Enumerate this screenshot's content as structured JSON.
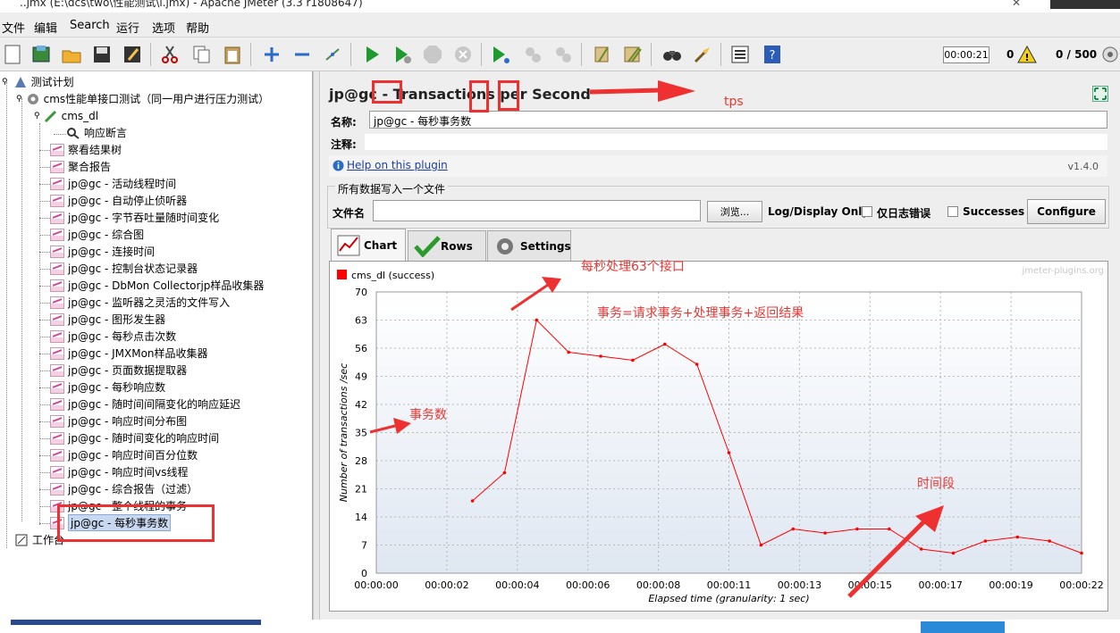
{
  "window": {
    "title": "..jmx (E:\\dcs\\two\\性能测试\\l.jmx) - Apache JMeter (3.3 r1808647)"
  },
  "menu": [
    "文件",
    "编辑",
    "Search",
    "运行",
    "选项",
    "帮助"
  ],
  "toolbar": {
    "timer": "00:00:21",
    "error_count": "0",
    "threads": "0 / 500",
    "icons": [
      "new-icon",
      "templates-icon",
      "open-icon",
      "save-icon",
      "save-as-icon",
      "cut-icon",
      "copy-icon",
      "paste-icon",
      "expand-icon",
      "collapse-icon",
      "toggle-icon",
      "start-icon",
      "start-no-pause-icon",
      "stop-icon",
      "shutdown-icon",
      "remote-start-icon",
      "remote-stop-icon",
      "remote-exit-icon",
      "clear-icon",
      "clear-all-icon",
      "search-icon",
      "reset-search-icon",
      "function-helper-icon",
      "help-icon"
    ]
  },
  "tree": {
    "root": "测试计划",
    "thread_group": "cms性能单接口测试（同一用户进行压力测试）",
    "sampler": "cms_dl",
    "assertion": "响应断言",
    "listeners": [
      "察看结果树",
      "聚合报告",
      "jp@gc - 活动线程时间",
      "jp@gc - 自动停止侦听器",
      "jp@gc - 字节吞吐量随时间变化",
      "jp@gc - 综合图",
      "jp@gc - 连接时间",
      "jp@gc - 控制台状态记录器",
      "jp@gc - DbMon Collectorjp样品收集器",
      "jp@gc - 监听器之灵活的文件写入",
      "jp@gc - 图形发生器",
      "jp@gc - 每秒点击次数",
      "jp@gc - JMXMon样品收集器",
      "jp@gc - 页面数据提取器",
      "jp@gc - 每秒响应数",
      "jp@gc - 随时间间隔变化的响应延迟",
      "jp@gc - 响应时间分布图",
      "jp@gc - 随时间变化的响应时间",
      "jp@gc - 响应时间百分位数",
      "jp@gc - 响应时间vs线程",
      "jp@gc - 综合报告（过滤）",
      "jp@gc - 整个线程的事务",
      "jp@gc - 每秒事务数"
    ],
    "workbench": "工作台"
  },
  "panel": {
    "title": "jp@gc - Transactions per Second",
    "name_label": "名称:",
    "name_value": "jp@gc - 每秒事务数",
    "comment_label": "注释:",
    "help_link": "Help on this plugin",
    "version": "v1.4.0",
    "file_group_title": "所有数据写入一个文件",
    "file_label": "文件名",
    "browse_button": "浏览...",
    "log_display_label": "Log/Display Only:",
    "errors_only_label": "仅日志错误",
    "successes_label": "Successes",
    "configure_button": "Configure",
    "tabs": [
      "Chart",
      "Rows",
      "Settings"
    ]
  },
  "chart_data": {
    "type": "line",
    "watermark": "jmeter-plugins.org",
    "xlabel": "Elapsed time (granularity: 1 sec)",
    "ylabel": "Number of transactions /sec",
    "ylim": [
      0,
      70
    ],
    "yticks": [
      "0",
      "7",
      "14",
      "21",
      "28",
      "35",
      "42",
      "49",
      "56",
      "63",
      "70"
    ],
    "xticks": [
      "00:00:00",
      "00:00:02",
      "00:00:04",
      "00:00:06",
      "00:00:08",
      "00:00:11",
      "00:00:13",
      "00:00:15",
      "00:00:17",
      "00:00:19",
      "00:00:22"
    ],
    "grid": true,
    "legend": "top-left",
    "series": [
      {
        "name": "cms_dl (success)",
        "color": "#ff0000",
        "x": [
          3,
          4,
          5,
          6,
          7,
          8,
          9,
          10,
          11,
          12,
          13,
          14,
          15,
          16,
          17,
          18,
          19,
          20,
          21,
          22
        ],
        "y": [
          18,
          25,
          63,
          55,
          54,
          53,
          57,
          52,
          30,
          7,
          11,
          10,
          11,
          11,
          6,
          5,
          8,
          9,
          8,
          5
        ]
      }
    ]
  },
  "annotations": {
    "tps": "tps",
    "per_sec": "每秒处理63个接口",
    "definition": "事务=请求事务+处理事务+返回结果",
    "transactions": "事务数",
    "period": "时间段"
  }
}
